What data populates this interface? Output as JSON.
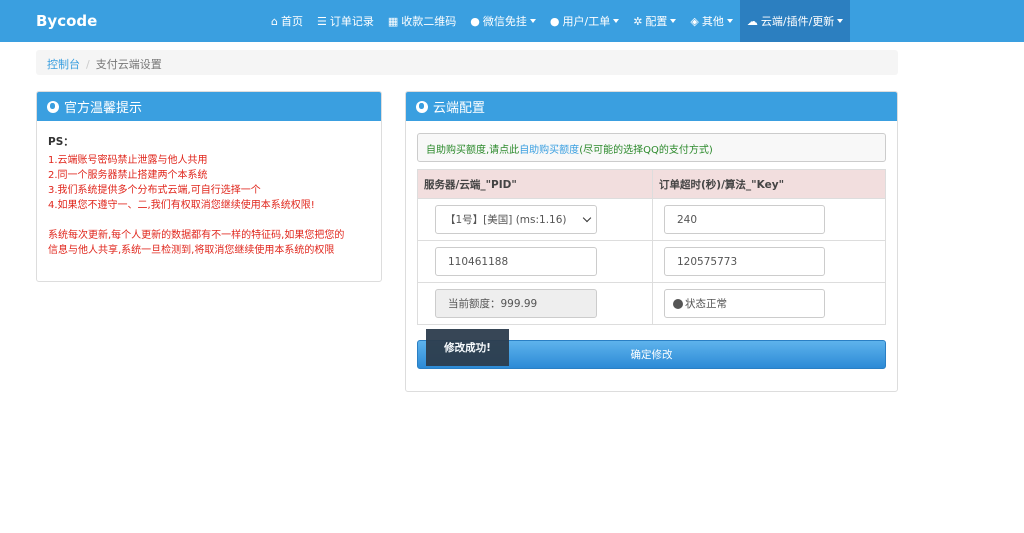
{
  "navbar": {
    "brand": "Bycode",
    "items": [
      {
        "label": "首页",
        "icon": "home-icon",
        "dropdown": false,
        "active": false
      },
      {
        "label": "订单记录",
        "icon": "list-icon",
        "dropdown": false,
        "active": false
      },
      {
        "label": "收款二维码",
        "icon": "qrcode-icon",
        "dropdown": false,
        "active": false
      },
      {
        "label": "微信免挂",
        "icon": "wechat-icon",
        "dropdown": true,
        "active": false
      },
      {
        "label": "用户/工单",
        "icon": "user-icon",
        "dropdown": true,
        "active": false
      },
      {
        "label": "配置",
        "icon": "gear-icon",
        "dropdown": true,
        "active": false
      },
      {
        "label": "其他",
        "icon": "cube-icon",
        "dropdown": true,
        "active": false
      },
      {
        "label": "云端/插件/更新",
        "icon": "cloud-icon",
        "dropdown": true,
        "active": true
      }
    ]
  },
  "breadcrumb": {
    "home": "控制台",
    "separator": "/",
    "current": "支付云端设置"
  },
  "notice": {
    "title": "官方温馨提示",
    "ps": "PS：",
    "lines": [
      "1.云端账号密码禁止泄露与他人共用",
      "2.同一个服务器禁止搭建两个本系统",
      "3.我们系统提供多个分布式云端,可自行选择一个",
      "4.如果您不遵守一、二,我们有权取消您继续使用本系统权限!"
    ],
    "paragraph_1": "系统每次更新,每个人更新的数据都有不一样的特征码,如果您把您的",
    "paragraph_2": "信息与他人共享,系统一旦检测到,将取消您继续使用本系统的权限"
  },
  "cloud": {
    "title": "云端配置",
    "alert_prefix": "自助购买额度,请点此",
    "alert_link": "自助购买额度",
    "alert_suffix": "(尽可能的选择QQ的支付方式)",
    "col1_header": "服务器/云端_\"PID\"",
    "col2_header": "订单超时(秒)/算法_\"Key\"",
    "server_select": "【1号】[美国] (ms:1.16)",
    "timeout_value": "240",
    "pid_value": "110461188",
    "key_value": "120575773",
    "quota_value": "当前额度：999.99",
    "status_value": "状态正常",
    "submit_label": "确定修改"
  },
  "toast": {
    "message": "修改成功!"
  },
  "colors": {
    "primary": "#3a9fe0",
    "active_nav": "#2c7fc0",
    "warning_text": "#e0261c",
    "alert_text": "#2c8a2c",
    "table_header_bg": "#f2dede",
    "toast_bg": "#2d3d4d"
  }
}
